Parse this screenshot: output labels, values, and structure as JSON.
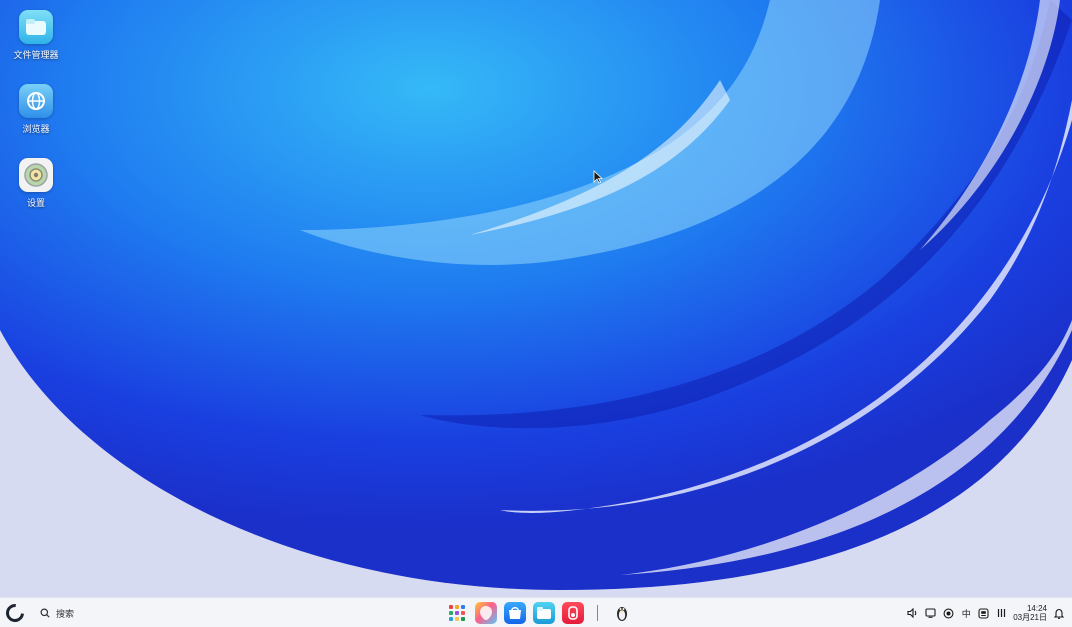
{
  "desktop": {
    "icons": [
      {
        "label": "文件管理器",
        "icon": "folder-icon"
      },
      {
        "label": "浏览器",
        "icon": "globe-icon"
      },
      {
        "label": "设置",
        "icon": "gear-icon"
      }
    ]
  },
  "taskbar": {
    "start_icon": "start-icon",
    "search_label": "搜索",
    "dock": [
      {
        "icon": "app-launcher-icon"
      },
      {
        "icon": "color-app-icon"
      },
      {
        "icon": "app-store-icon"
      },
      {
        "icon": "file-manager-icon"
      },
      {
        "icon": "red-app-icon"
      },
      {
        "icon": "penguin-icon"
      }
    ],
    "tray": {
      "volume_icon": "volume-icon",
      "screen_icon": "screen-icon",
      "record_icon": "record-icon",
      "ime_label": "中",
      "network_icon": "network-icon",
      "bars_icon": "bars-icon",
      "time": "14:24",
      "date": "03月21日",
      "notification_icon": "bell-icon"
    }
  },
  "colors": {
    "wallpaper_deep_blue": "#1536e0",
    "wallpaper_light": "#d9dcf3",
    "taskbar_bg": "#f4f5f9"
  }
}
